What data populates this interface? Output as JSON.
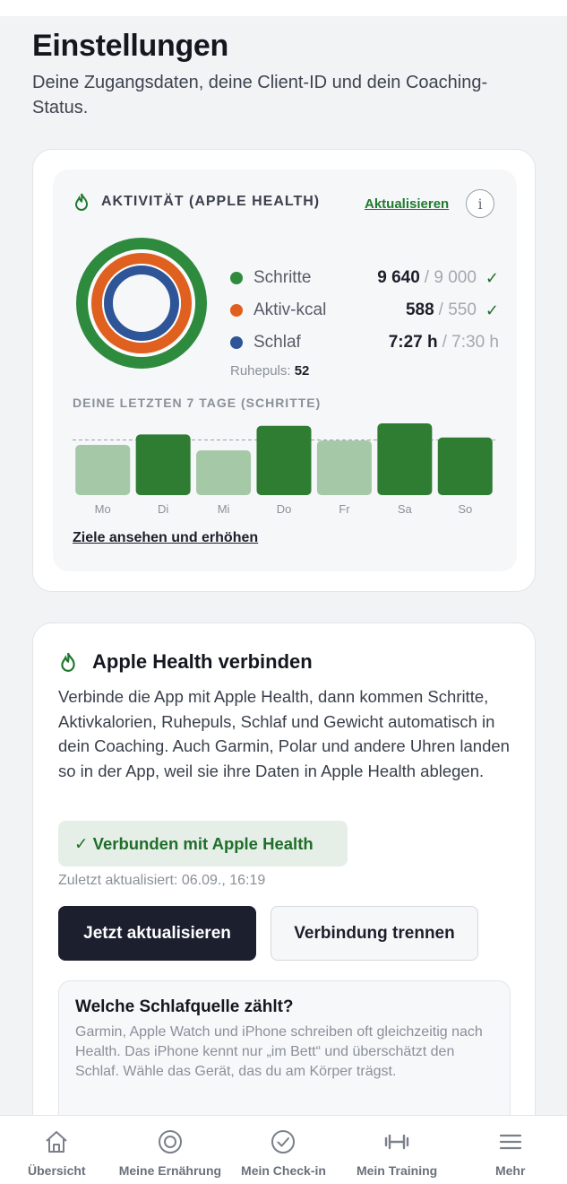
{
  "header": {
    "title": "Einstellungen",
    "subtitle": "Deine Zugangsdaten, deine Client-ID und dein Coaching-Status."
  },
  "activity": {
    "title": "AKTIVITÄT (APPLE HEALTH)",
    "refresh_label": "Aktualisieren",
    "info_label": "i",
    "metrics": [
      {
        "label": "Schritte",
        "value": "9 640",
        "goal": "/ 9 000",
        "check": "✓",
        "color": "#2e8b3e",
        "progress": 1.0
      },
      {
        "label": "Aktiv-kcal",
        "value": "588",
        "goal": "/ 550",
        "check": "✓",
        "color": "#e0601f",
        "progress": 1.0
      },
      {
        "label": "Schlaf",
        "value": "7:27 h",
        "goal": "/ 7:30 h",
        "check": "",
        "color": "#2d5597",
        "progress": 0.99
      }
    ],
    "resting_label": "Ruhepuls:",
    "resting_value": "52",
    "week_title": "DEINE LETZTEN 7 TAGE (SCHRITTE)",
    "goals_link": "Ziele ansehen und erhöhen"
  },
  "chart_data": {
    "type": "bar",
    "categories": [
      "Mo",
      "Di",
      "Mi",
      "Do",
      "Fr",
      "Sa",
      "So"
    ],
    "values": [
      8200,
      9900,
      7300,
      11300,
      8900,
      11700,
      9400
    ],
    "goal": 9000,
    "ylim": [
      0,
      12000
    ],
    "colors": {
      "met": "#2e7d32",
      "missed": "#a5c8a7",
      "goal_line": "#9aa0a8"
    }
  },
  "connect": {
    "title": "Apple Health verbinden",
    "description": "Verbinde die App mit Apple Health, dann kommen Schritte, Aktivkalorien, Ruhepuls, Schlaf und Gewicht automatisch in dein Coaching. Auch Garmin, Polar und andere Uhren landen so in der App, weil sie ihre Daten in Apple Health ablegen.",
    "status": "✓ Verbunden mit Apple Health",
    "last_updated": "Zuletzt aktualisiert: 06.09., 16:19",
    "update_button": "Jetzt aktualisieren",
    "disconnect_button": "Verbindung trennen",
    "sleep_source": {
      "title": "Welche Schlafquelle zählt?",
      "text": "Garmin, Apple Watch und iPhone schreiben oft gleichzeitig nach Health. Das iPhone kennt nur „im Bett“ und überschätzt den Schlaf. Wähle das Gerät, das du am Körper trägst."
    }
  },
  "tabs": [
    {
      "label": "Übersicht",
      "icon": "home-icon"
    },
    {
      "label": "Meine Ernährung",
      "icon": "target-icon"
    },
    {
      "label": "Mein Check-in",
      "icon": "check-circle-icon"
    },
    {
      "label": "Mein Training",
      "icon": "dumbbell-icon"
    },
    {
      "label": "Mehr",
      "icon": "menu-icon"
    }
  ]
}
